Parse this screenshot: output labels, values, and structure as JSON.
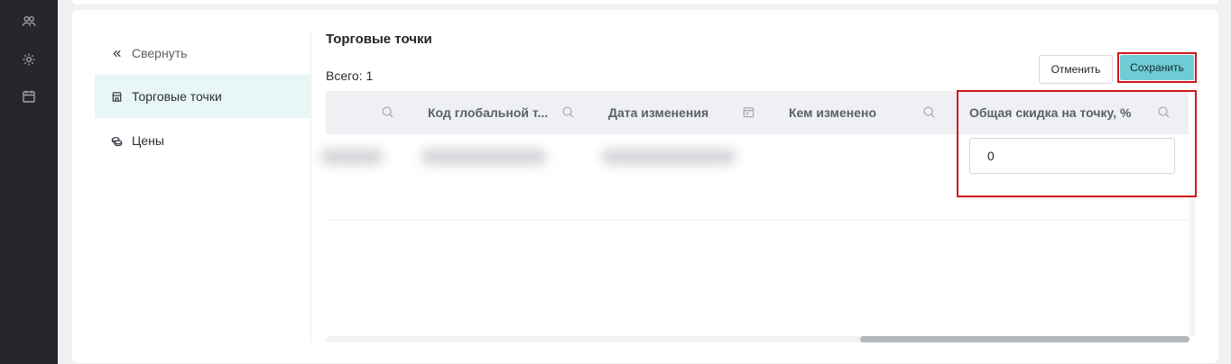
{
  "rail": {
    "icons": [
      "users-icon",
      "gear-icon",
      "calendar-icon"
    ]
  },
  "sidebar": {
    "collapse_label": "Свернуть",
    "items": [
      {
        "label": "Торговые точки",
        "icon": "store-icon",
        "active": true
      },
      {
        "label": "Цены",
        "icon": "coins-icon",
        "active": false
      }
    ]
  },
  "main": {
    "title": "Торговые точки",
    "total": "Всего: 1",
    "cancel_label": "Отменить",
    "save_label": "Сохранить"
  },
  "table": {
    "columns": [
      {
        "label": "",
        "icon": "search-icon"
      },
      {
        "label": "Код глобальной т...",
        "icon": "search-icon"
      },
      {
        "label": "Дата изменения",
        "icon": "calendar-icon"
      },
      {
        "label": "Кем изменено",
        "icon": "search-icon"
      },
      {
        "label": "Общая скидка на точку, %",
        "icon": "search-icon"
      }
    ],
    "rows": [
      {
        "discount_value": "0"
      }
    ]
  },
  "colors": {
    "accent": "#70ccd4",
    "highlight": "#d0161c",
    "active_menu_bg": "#e8f6f6",
    "rail_bg": "#26272b"
  }
}
